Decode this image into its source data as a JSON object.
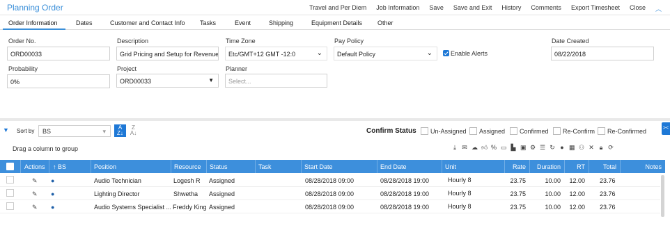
{
  "app": {
    "title": "Planning Order"
  },
  "topmenu": [
    "Travel and Per Diem",
    "Job Information",
    "Save",
    "Save and Exit",
    "History",
    "Comments",
    "Export Timesheet",
    "Close"
  ],
  "tabs": [
    "Order Information",
    "Dates",
    "Customer and Contact Info",
    "Tasks",
    "Event",
    "Shipping",
    "Equipment Details",
    "Other"
  ],
  "form": {
    "order_no": {
      "label": "Order No.",
      "value": "ORD00033"
    },
    "description": {
      "label": "Description",
      "value": "Grid Pricing and Setup for Revenue"
    },
    "time_zone": {
      "label": "Time Zone",
      "value": "Etc/GMT+12 GMT -12:0"
    },
    "pay_policy": {
      "label": "Pay Policy",
      "value": "Default Policy"
    },
    "enable_alerts": {
      "label": "Enable Alerts",
      "checked": true
    },
    "date_created": {
      "label": "Date Created",
      "value": "08/22/2018"
    },
    "probability": {
      "label": "Probability",
      "value": "0%"
    },
    "project": {
      "label": "Project",
      "value": "ORD00033"
    },
    "planner": {
      "label": "Planner",
      "placeholder": "Select..."
    }
  },
  "sort": {
    "label": "Sort by",
    "value": "BS"
  },
  "confirm_status": {
    "title": "Confirm Status",
    "options": [
      "Un-Assigned",
      "Assigned",
      "Confirmed",
      "Re-Confirm",
      "Re-Confirmed"
    ]
  },
  "drag_hint": "Drag a column to group",
  "toolbar_icons": [
    "export-icon",
    "email-icon",
    "cloud-icon",
    "thumbs-up-icon",
    "percent-icon",
    "card-icon",
    "chart-icon",
    "calendar-icon",
    "settings-icon",
    "list-icon",
    "refresh-icon",
    "user-icon",
    "schedule-icon",
    "users-icon",
    "remove-icon",
    "lock-icon",
    "reload-icon"
  ],
  "grid": {
    "columns": [
      "Actions",
      "BS",
      "Position",
      "Resource",
      "Status",
      "Task",
      "Start Date",
      "End Date",
      "Unit",
      "Rate",
      "Duration",
      "RT",
      "Total",
      "Notes"
    ],
    "sort_glyph": "↑",
    "rows": [
      {
        "position": "Audio Technician",
        "resource": "Logesh R",
        "status": "Assigned",
        "task": "",
        "start": "08/28/2018 09:00",
        "end": "08/28/2018 19:00",
        "unit": "Hourly 8",
        "rate": "23.75",
        "duration": "10.00",
        "rt": "12.00",
        "total": "23.76",
        "notes": ""
      },
      {
        "position": "Lighting Director",
        "resource": "Shwetha",
        "status": "Assigned",
        "task": "",
        "start": "08/28/2018 09:00",
        "end": "08/28/2018 19:00",
        "unit": "Hourly 8",
        "rate": "23.75",
        "duration": "10.00",
        "rt": "12.00",
        "total": "23.76",
        "notes": ""
      },
      {
        "position": "Audio Systems Specialist ...",
        "resource": "Freddy King",
        "status": "Assigned",
        "task": "",
        "start": "08/28/2018 09:00",
        "end": "08/28/2018 19:00",
        "unit": "Hourly 8",
        "rate": "23.75",
        "duration": "10.00",
        "rt": "12.00",
        "total": "23.76",
        "notes": ""
      }
    ]
  },
  "colors": {
    "accent": "#3a8fd9",
    "header": "#3d8fdc",
    "checkbox": "#1e78d6"
  }
}
